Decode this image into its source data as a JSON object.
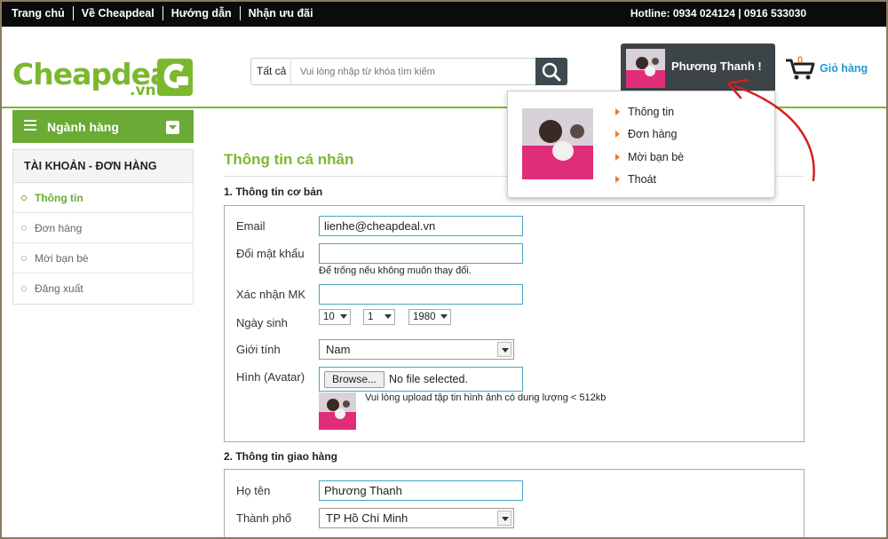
{
  "topbar": {
    "nav": [
      "Trang chủ",
      "Về Cheapdeal",
      "Hướng dẫn",
      "Nhận ưu đãi"
    ],
    "hotline": "Hotline: 0934 024124 | 0916 533030"
  },
  "header": {
    "logo_text": "Cheapdeal",
    "logo_suffix": ".vn",
    "search_category": "Tất cả",
    "search_placeholder": "Vui lòng nhập từ khóa tìm kiếm",
    "user_name": "Phương Thanh !",
    "cart_label": "Giỏ hàng",
    "cart_count": "0"
  },
  "user_menu": [
    "Thông tin",
    "Đơn hàng",
    "Mời bạn bè",
    "Thoát"
  ],
  "sidebar": {
    "category_label": "Ngành hàng",
    "account_title": "TÀI KHOẢN - ĐƠN HÀNG",
    "items": [
      "Thông tin",
      "Đơn hàng",
      "Mời bạn bè",
      "Đăng xuất"
    ]
  },
  "main": {
    "title": "Thông tin cá nhân",
    "section1_title": "1. Thông tin cơ bản",
    "email_label": "Email",
    "email_value": "lienhe@cheapdeal.vn",
    "password_label": "Đổi mật khẩu",
    "password_hint": "Để trống nếu không muốn thay đổi.",
    "confirm_label": "Xác nhận MK",
    "birthday_label": "Ngày sinh",
    "birth_day": "10",
    "birth_month": "1",
    "birth_year": "1980",
    "gender_label": "Giới tính",
    "gender_value": "Nam",
    "avatar_label": "Hình (Avatar)",
    "browse_label": "Browse...",
    "no_file": "No file selected.",
    "avatar_hint": "Vui lòng upload tập tin hình ảnh có dung lượng < 512kb",
    "section2_title": "2. Thông tin giao hàng",
    "fullname_label": "Họ tên",
    "fullname_value": "Phương Thanh",
    "city_label": "Thành phố",
    "city_value": "TP Hồ Chí Minh"
  },
  "colors": {
    "brand_green": "#7cb82f",
    "sidebar_green": "#6aaa35",
    "topbar": "#0b0b0b",
    "user_box": "#3c4448",
    "link_blue": "#1d9bd1",
    "accent_orange": "#ee7a22",
    "annotation_red": "#d42020"
  }
}
